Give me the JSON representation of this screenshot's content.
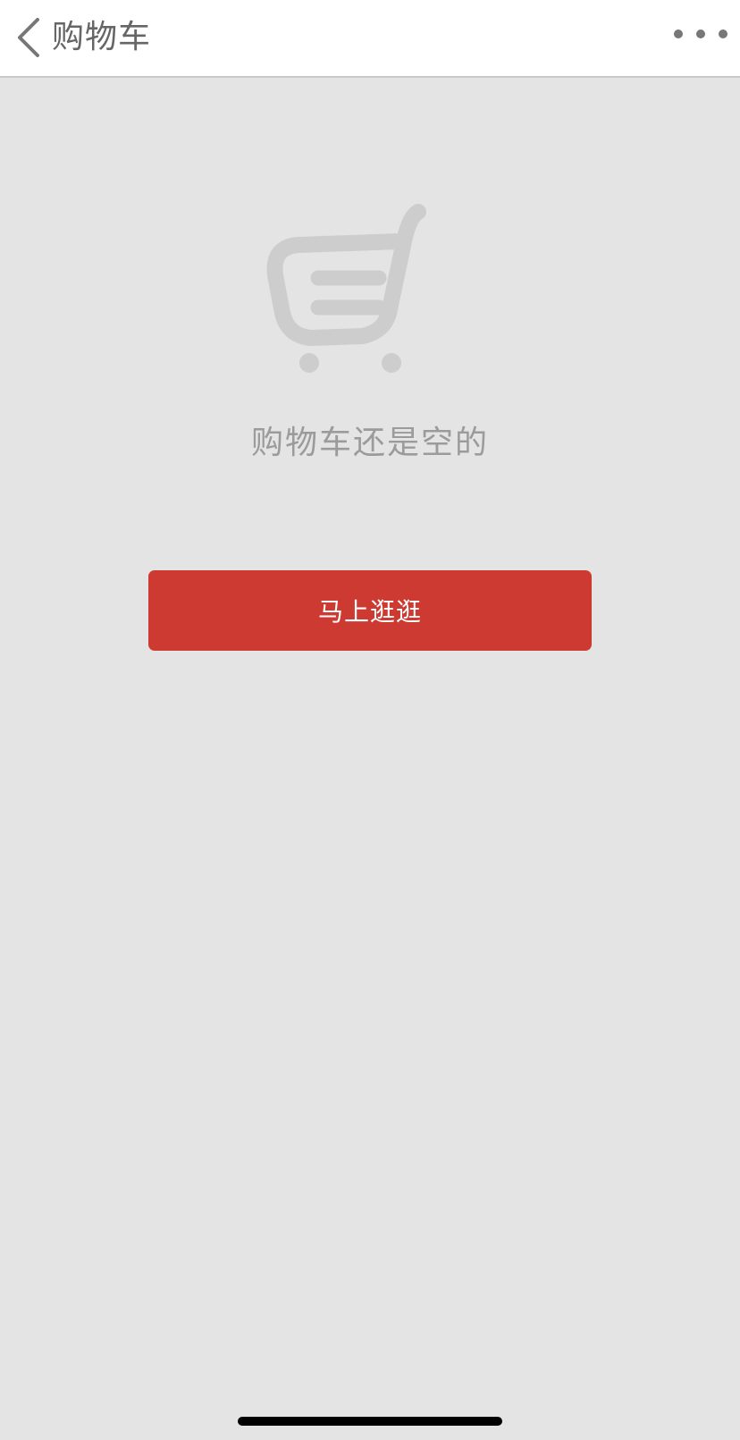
{
  "nav": {
    "back_icon": "chevron-left-icon",
    "title": "购物车",
    "more_icon": "more-horizontal-icon"
  },
  "empty_state": {
    "icon": "shopping-cart-icon",
    "message": "购物车还是空的",
    "action_label": "马上逛逛"
  },
  "colors": {
    "background": "#e4e4e4",
    "nav_background": "#ffffff",
    "accent": "#cd3a31",
    "muted_text": "#9b9b9b",
    "cart_icon": "#cdcdcd"
  }
}
